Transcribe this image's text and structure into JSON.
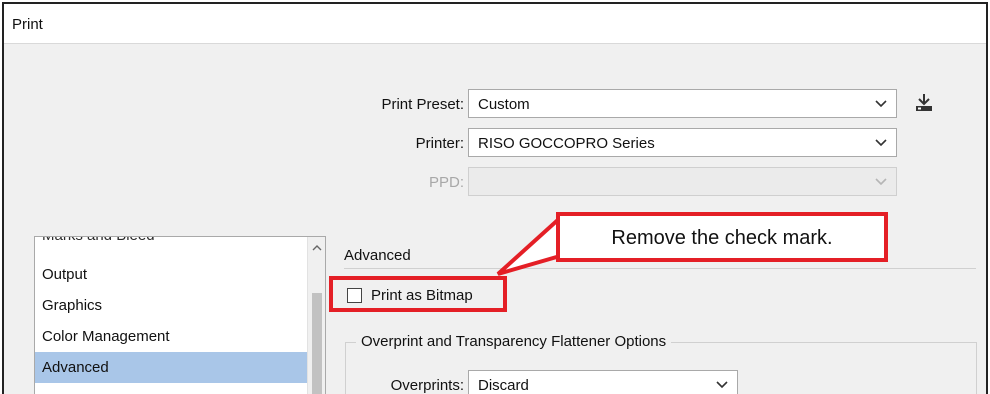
{
  "window": {
    "title": "Print"
  },
  "preset": {
    "label": "Print Preset:",
    "value": "Custom",
    "save_icon": "save-preset-icon"
  },
  "printer": {
    "label": "Printer:",
    "value": "RISO GOCCOPRO Series"
  },
  "ppd": {
    "label": "PPD:",
    "value": ""
  },
  "sidebar": {
    "items": [
      {
        "label": "Marks and Bleed"
      },
      {
        "label": "Output"
      },
      {
        "label": "Graphics"
      },
      {
        "label": "Color Management"
      },
      {
        "label": "Advanced"
      }
    ],
    "selected": "Advanced"
  },
  "advanced": {
    "title": "Advanced",
    "print_as_bitmap": {
      "label": "Print as Bitmap",
      "checked": false
    },
    "group_title": "Overprint and Transparency Flattener Options",
    "overprints": {
      "label": "Overprints:",
      "value": "Discard"
    }
  },
  "annotation": {
    "text": "Remove the check mark.",
    "color": "#e41f26"
  }
}
